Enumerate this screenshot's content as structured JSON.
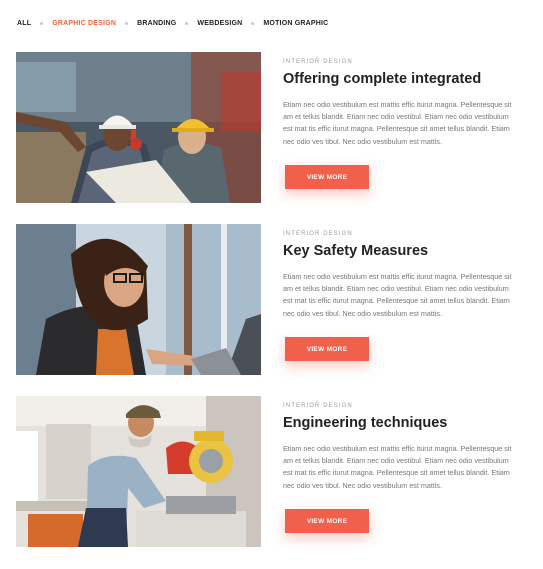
{
  "filters": [
    {
      "label": "ALL"
    },
    {
      "label": "GRAPHIC DESIGN"
    },
    {
      "label": "BRANDING"
    },
    {
      "label": "WEBDESIGN"
    },
    {
      "label": "MOTION GRAPHIC"
    }
  ],
  "active_filter": "GRAPHIC DESIGN",
  "colors": {
    "accent": "#f0643f",
    "button": "#f0604a"
  },
  "posts": [
    {
      "category": "INTERIOR DESIGN",
      "title": "Offering complete integrated",
      "excerpt": "Etiam nec odio vestibulum est mattis effic iturut magna. Pellentesque sit am et tellus blandit. Etiam nec odio vestibul. Etiam nec odio vestibulum est mat tis effic iturut magna. Pellentesque sit amet tellus blandit. Etiam nec odio ves tibul.  Nec odio vestibulum est mattis.",
      "button": "VIEW MORE",
      "image": "two-engineers-in-hard-hats-photo"
    },
    {
      "category": "INTERIOR DESIGN",
      "title": "Key Safety Measures",
      "excerpt": "Etiam nec odio vestibulum est mattis effic iturut magna. Pellentesque sit am et tellus blandit. Etiam nec odio vestibul. Etiam nec odio vestibulum est mat tis effic iturut magna. Pellentesque sit amet tellus blandit. Etiam nec odio ves tibul.  Nec odio vestibulum est mattis.",
      "button": "VIEW MORE",
      "image": "woman-at-laptop-photo"
    },
    {
      "category": "INTERIOR DESIGN",
      "title": "Engineering techniques",
      "excerpt": "Etiam nec odio vestibulum est mattis effic iturut magna. Pellentesque sit am et tellus blandit. Etiam nec odio vestibul. Etiam nec odio vestibulum est mat tis effic iturut magna. Pellentesque sit amet tellus blandit. Etiam nec odio ves tibul.  Nec odio vestibulum est mattis.",
      "button": "VIEW MORE",
      "image": "man-using-miter-saw-photo"
    }
  ]
}
